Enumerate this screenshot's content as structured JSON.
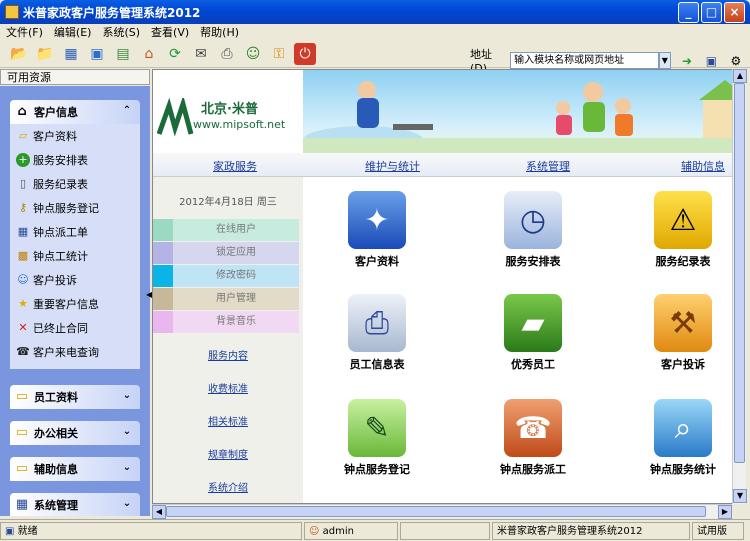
{
  "window": {
    "title": "米普家政客户服务管理系统2012",
    "min": "_",
    "max": "□",
    "close": "×"
  },
  "menu": [
    "文件(F)",
    "编辑(E)",
    "系统(S)",
    "查看(V)",
    "帮助(H)"
  ],
  "address": {
    "label": "地址(D)",
    "value": "输入模块名称或网页地址"
  },
  "sidebar": {
    "header": "可用资源",
    "groups": [
      {
        "label": "客户信息",
        "icon": "house-icon",
        "expanded": true
      },
      {
        "label": "员工资料",
        "icon": "folder-icon",
        "expanded": false
      },
      {
        "label": "办公相关",
        "icon": "folder-icon",
        "expanded": false
      },
      {
        "label": "辅助信息",
        "icon": "folder-icon",
        "expanded": false
      },
      {
        "label": "系统管理",
        "icon": "grid-icon",
        "expanded": false
      }
    ],
    "items": [
      {
        "label": "客户资料",
        "icon": "folder-open-icon"
      },
      {
        "label": "服务安排表",
        "icon": "green-plus-icon"
      },
      {
        "label": "服务纪录表",
        "icon": "document-icon"
      },
      {
        "label": "钟点服务登记",
        "icon": "key-icon"
      },
      {
        "label": "钟点派工单",
        "icon": "table-icon"
      },
      {
        "label": "钟点工统计",
        "icon": "gift-icon"
      },
      {
        "label": "客户投诉",
        "icon": "person-icon"
      },
      {
        "label": "重要客户信息",
        "icon": "star-icon"
      },
      {
        "label": "已终止合同",
        "icon": "x-icon"
      },
      {
        "label": "客户来电查询",
        "icon": "phone-icon"
      }
    ]
  },
  "banner": {
    "brand_cn": "北京·米普",
    "brand_url": "www.mipsoft.net"
  },
  "nav": [
    "家政服务",
    "维护与统计",
    "系统管理",
    "辅助信息"
  ],
  "leftcol": {
    "date": "2012年4月18日  周三",
    "quick": [
      {
        "label": "在线用户",
        "color": "#c8ebdf"
      },
      {
        "label": "锁定应用",
        "color": "#d6d6ef"
      },
      {
        "label": "修改密码",
        "color": "#bfe4f5"
      },
      {
        "label": "用户管理",
        "color": "#e2dbc8"
      },
      {
        "label": "背景音乐",
        "color": "#f1d9f3"
      }
    ],
    "links": [
      "服务内容",
      "收费标准",
      "相关标准",
      "规章制度",
      "系统介绍"
    ]
  },
  "modules": [
    {
      "label": "客户资料",
      "icon": "compass-folder-icon"
    },
    {
      "label": "服务安排表",
      "icon": "clock-folder-icon"
    },
    {
      "label": "服务纪录表",
      "icon": "roadwork-folder-icon"
    },
    {
      "label": "员工信息表",
      "icon": "printer-icon"
    },
    {
      "label": "优秀员工",
      "icon": "book-icon"
    },
    {
      "label": "客户投诉",
      "icon": "gavel-icon"
    },
    {
      "label": "钟点服务登记",
      "icon": "pen-tablet-icon"
    },
    {
      "label": "钟点服务派工",
      "icon": "operator-icon"
    },
    {
      "label": "钟点服务统计",
      "icon": "globe-magnifier-icon"
    }
  ],
  "status": {
    "ready": "就绪",
    "user": "admin",
    "app": "米普家政客户服务管理系统2012",
    "edition": "试用版"
  }
}
